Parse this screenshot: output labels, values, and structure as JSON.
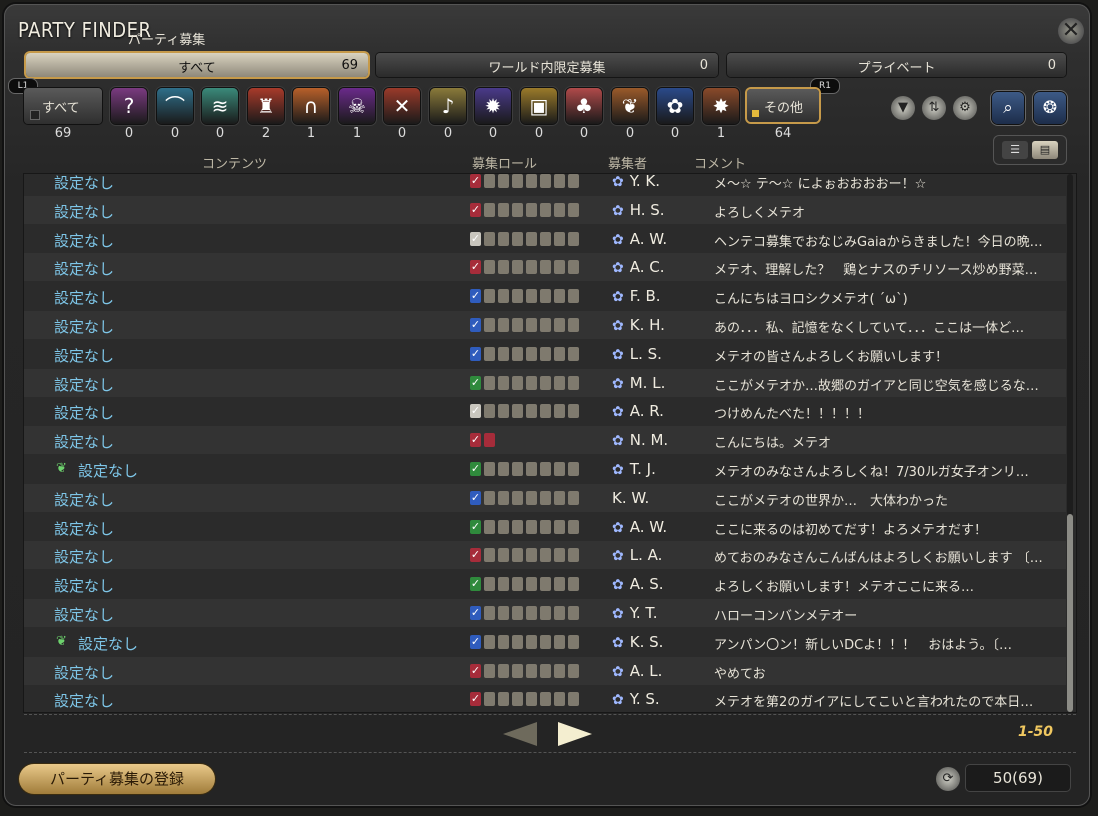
{
  "title": "PARTY FINDER",
  "subtitle": "パーティ募集",
  "tabs": [
    {
      "label": "すべて",
      "count": "69"
    },
    {
      "label": "ワールド内限定募集",
      "count": "0"
    },
    {
      "label": "プライベート",
      "count": "0"
    }
  ],
  "badges": {
    "l1": "L1",
    "r1": "R1"
  },
  "category_all": {
    "label": "すべて",
    "count": "69"
  },
  "categories": [
    {
      "icon": "question-icon",
      "glyph": "?",
      "count": "0",
      "color": "#7a3a80"
    },
    {
      "icon": "dungeon-icon",
      "glyph": "⌒",
      "count": "0",
      "color": "#2f6f8a"
    },
    {
      "icon": "guildhest-icon",
      "glyph": "≋",
      "count": "0",
      "color": "#3a8a7a"
    },
    {
      "icon": "trial-icon",
      "glyph": "♜",
      "count": "2",
      "color": "#a83a2a"
    },
    {
      "icon": "raid-icon",
      "glyph": "∩",
      "count": "1",
      "color": "#b8602a"
    },
    {
      "icon": "high-end-icon",
      "glyph": "☠",
      "count": "1",
      "color": "#6a2a8a"
    },
    {
      "icon": "pvp-icon",
      "glyph": "✕",
      "count": "0",
      "color": "#9a3a2a"
    },
    {
      "icon": "gold-saucer-icon",
      "glyph": "♪",
      "count": "0",
      "color": "#8a7a3a"
    },
    {
      "icon": "fate-icon",
      "glyph": "✹",
      "count": "0",
      "color": "#4a3a8a"
    },
    {
      "icon": "treasure-hunt-icon",
      "glyph": "▣",
      "count": "0",
      "color": "#9a7a2a"
    },
    {
      "icon": "hunt-icon",
      "glyph": "♣",
      "count": "0",
      "color": "#b04a4a"
    },
    {
      "icon": "gathering-icon",
      "glyph": "❦",
      "count": "0",
      "color": "#9a5a2a"
    },
    {
      "icon": "deep-dungeon-icon",
      "glyph": "✿",
      "count": "0",
      "color": "#2a4a8a"
    },
    {
      "icon": "adventuring-forays-icon",
      "glyph": "✸",
      "count": "1",
      "color": "#8a4a2a"
    }
  ],
  "category_other": {
    "label": "その他",
    "count": "64"
  },
  "headers": {
    "content": "コンテンツ",
    "role": "募集ロール",
    "recruiter": "募集者",
    "comment": "コメント"
  },
  "rows": [
    {
      "content": "設定なし",
      "sprout": false,
      "role": "dps",
      "slots": 8,
      "recruiter": "Y. K.",
      "flower": true,
      "comment": "メ～☆ テ～☆ によぉおおおおー！☆"
    },
    {
      "content": "設定なし",
      "sprout": false,
      "role": "dps",
      "slots": 8,
      "recruiter": "H. S.",
      "flower": true,
      "comment": "よろしくメテオ"
    },
    {
      "content": "設定なし",
      "sprout": false,
      "role": "all",
      "slots": 8,
      "recruiter": "A. W.",
      "flower": true,
      "comment": "ヘンテコ募集でおなじみGaiaからきました！今日の晩…"
    },
    {
      "content": "設定なし",
      "sprout": false,
      "role": "dps",
      "slots": 8,
      "recruiter": "A. C.",
      "flower": true,
      "comment": "メテオ、理解した？　鶏とナスのチリソース炒め野菜…"
    },
    {
      "content": "設定なし",
      "sprout": false,
      "role": "tank",
      "slots": 8,
      "recruiter": "F. B.",
      "flower": true,
      "comment": "こんにちはヨロシクメテオ( ´ω`)"
    },
    {
      "content": "設定なし",
      "sprout": false,
      "role": "tank",
      "slots": 8,
      "recruiter": "K. H.",
      "flower": true,
      "comment": "あの．．．私、記憶をなくしていて．．．ここは一体ど…"
    },
    {
      "content": "設定なし",
      "sprout": false,
      "role": "tank",
      "slots": 8,
      "recruiter": "L. S.",
      "flower": true,
      "comment": "メテオの皆さんよろしくお願いします！"
    },
    {
      "content": "設定なし",
      "sprout": false,
      "role": "healer",
      "slots": 8,
      "recruiter": "M. L.",
      "flower": true,
      "comment": "ここがメテオか…故郷のガイアと同じ空気を感じるな…"
    },
    {
      "content": "設定なし",
      "sprout": false,
      "role": "all",
      "slots": 8,
      "recruiter": "A. R.",
      "flower": true,
      "comment": "つけめんたべた！！！！！"
    },
    {
      "content": "設定なし",
      "sprout": false,
      "role": "dps",
      "slots": 2,
      "recruiter": "N. M.",
      "flower": true,
      "comment": "こんにちは。メテオ",
      "bracketed": [
        "こんにちは。",
        "メテオ"
      ]
    },
    {
      "content": "設定なし",
      "sprout": true,
      "role": "healer",
      "slots": 8,
      "recruiter": "T. J.",
      "flower": true,
      "comment": "メテオのみなさんよろしくね！7/30ルガ女子オンリ…"
    },
    {
      "content": "設定なし",
      "sprout": false,
      "role": "tank",
      "slots": 8,
      "recruiter": "K. W.",
      "flower": false,
      "comment": "ここがメテオの世界か…　大体わかった"
    },
    {
      "content": "設定なし",
      "sprout": false,
      "role": "healer",
      "slots": 8,
      "recruiter": "A. W.",
      "flower": true,
      "comment": "ここに来るのは初めてだす！よろメテオだす！"
    },
    {
      "content": "設定なし",
      "sprout": false,
      "role": "dps",
      "slots": 8,
      "recruiter": "L. A.",
      "flower": true,
      "comment": "めておのみなさんこんばんはよろしくお願いします 〔…"
    },
    {
      "content": "設定なし",
      "sprout": false,
      "role": "healer",
      "slots": 8,
      "recruiter": "A. S.",
      "flower": true,
      "comment": "よろしくお願いします！メテオここに来る…",
      "bracketed": [
        "よろしくお願いします！",
        "メテオ",
        "ここに来る…"
      ]
    },
    {
      "content": "設定なし",
      "sprout": false,
      "role": "tank",
      "slots": 8,
      "recruiter": "Y. T.",
      "flower": true,
      "comment": "ハローコンバンメテオー"
    },
    {
      "content": "設定なし",
      "sprout": true,
      "role": "tank",
      "slots": 8,
      "recruiter": "K. S.",
      "flower": true,
      "comment": "アンパン〇ン！新しいDCよ！！！　おはよう。〔…",
      "bracketed_tail": [
        "アンパン〇ン！新しいDCよ！！！　",
        "おはよう。"
      ]
    },
    {
      "content": "設定なし",
      "sprout": false,
      "role": "dps",
      "slots": 8,
      "recruiter": "A. L.",
      "flower": true,
      "comment": "やめてお"
    },
    {
      "content": "設定なし",
      "sprout": false,
      "role": "dps",
      "slots": 8,
      "recruiter": "Y. S.",
      "flower": true,
      "comment": "メテオを第2のガイアにしてこいと言われたので本日…"
    }
  ],
  "pagination": {
    "range": "1-50"
  },
  "register_label": "パーティ募集の登録",
  "listing_count": "50(69)",
  "colors": {
    "tank": "#2f5cbd",
    "healer": "#2f8a3c",
    "dps": "#a62c3a",
    "accent": "#c69a4a"
  }
}
